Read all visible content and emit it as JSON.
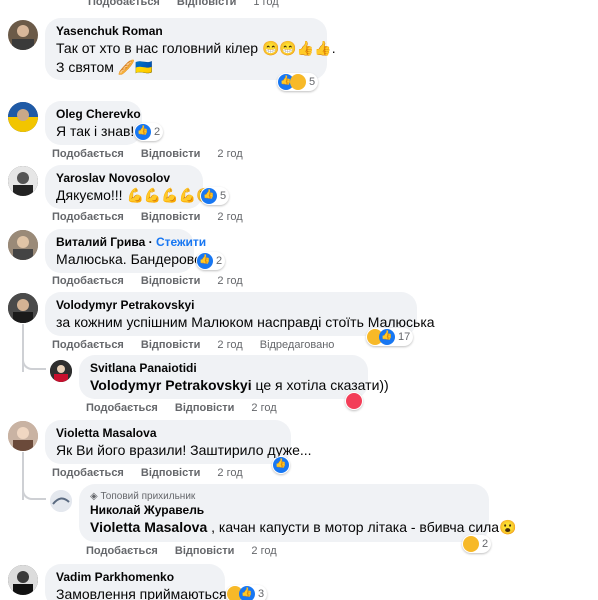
{
  "top": {
    "like": "Подобається",
    "reply": "Відповісти",
    "time": "1 год"
  },
  "comments": [
    {
      "author": "Yasenchuk Roman",
      "lines": [
        "Так от хто в нас головний кілер 😁😁👍👍.",
        "З святом 🥖🇺🇦"
      ],
      "reactions": "5"
    },
    {
      "author": "Oleg Cherevko",
      "text": "Я так і знав!",
      "reactions": "2",
      "like": "Подобається",
      "reply": "Відповісти",
      "time": "2 год"
    },
    {
      "author": "Yaroslav Novosolov",
      "text": "Дякуємо!!! 💪💪💪💪😘",
      "reactions": "5",
      "like": "Подобається",
      "reply": "Відповісти",
      "time": "2 год"
    },
    {
      "author": "Виталий Грива",
      "follow": "Стежити",
      "text": "Малюська. Бандеровец!",
      "reactions": "2",
      "like": "Подобається",
      "reply": "Відповісти",
      "time": "2 год"
    },
    {
      "author": "Volodymyr Petrakovskyi",
      "text": "за кожним успішним Малюком насправді стоїть Малюська",
      "reactions": "17",
      "like": "Подобається",
      "reply": "Відповісти",
      "time": "2 год",
      "edited": "Відредаговано"
    },
    {
      "author": "Svitlana Panaiotidi",
      "mention": "Volodymyr Petrakovskyi",
      "text": " це я хотіла сказати))",
      "like": "Подобається",
      "reply": "Відповісти",
      "time": "2 год"
    },
    {
      "author": "Violetta Masalova",
      "text": "Як Ви його вразили! Заштирило дуже...",
      "like": "Подобається",
      "reply": "Відповісти",
      "time": "2 год"
    },
    {
      "badge": "Топовий прихильник",
      "author": "Николай Журавель",
      "mention": "Violetta Masalova",
      "text": " , качан капусти в мотор літака - вбивча сила😮",
      "reactions": "2",
      "like": "Подобається",
      "reply": "Відповісти",
      "time": "2 год"
    },
    {
      "author": "Vadim Parkhomenko",
      "text": "Замовлення приймаються?)",
      "reactions": "3"
    }
  ],
  "colors": {
    "bubble": "#f0f2f5",
    "link": "#1877f2",
    "meta": "#65676b"
  }
}
